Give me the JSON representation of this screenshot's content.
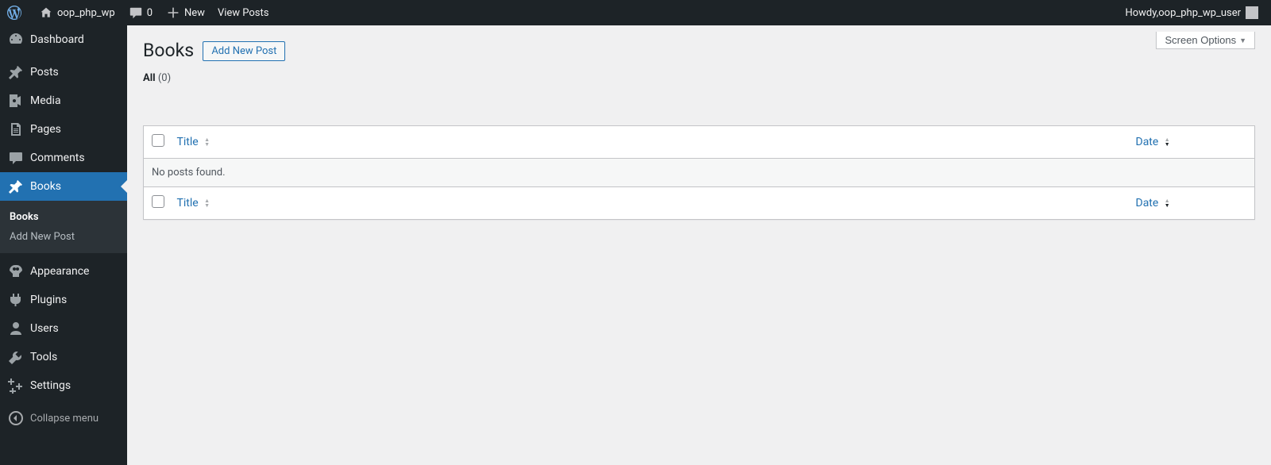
{
  "adminbar": {
    "site_name": "oop_php_wp",
    "comments_count": "0",
    "new_label": "New",
    "view_posts_label": "View Posts",
    "howdy_prefix": "Howdy, ",
    "user_name": "oop_php_wp_user"
  },
  "menu": {
    "dashboard": "Dashboard",
    "posts": "Posts",
    "media": "Media",
    "pages": "Pages",
    "comments": "Comments",
    "books": "Books",
    "appearance": "Appearance",
    "plugins": "Plugins",
    "users": "Users",
    "tools": "Tools",
    "settings": "Settings",
    "collapse": "Collapse menu"
  },
  "submenu": {
    "books": "Books",
    "add_new_post": "Add New Post"
  },
  "screen_options_label": "Screen Options",
  "page_title": "Books",
  "add_new_button": "Add New Post",
  "filters": {
    "all_label": "All",
    "all_count": "(0)"
  },
  "table": {
    "title_header": "Title",
    "date_header": "Date",
    "empty_message": "No posts found."
  }
}
